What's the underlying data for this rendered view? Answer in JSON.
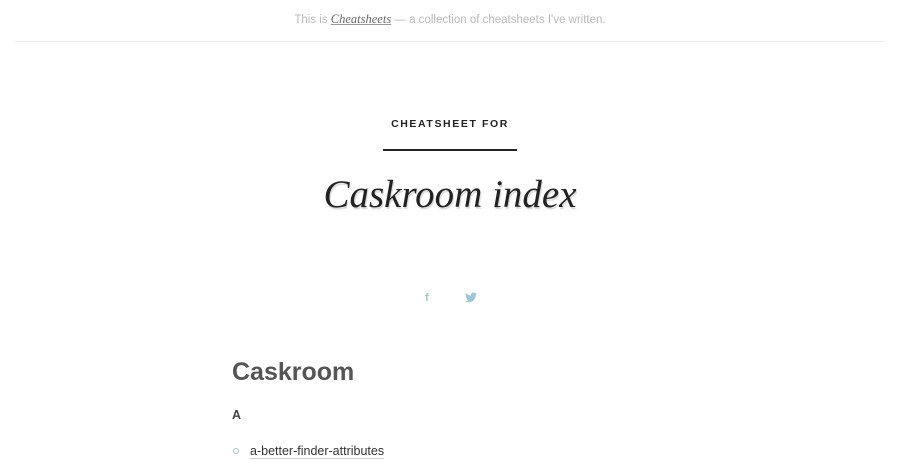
{
  "header": {
    "intro_prefix": "This is ",
    "site_name": "Cheatsheets",
    "intro_suffix": " — a collection of cheatsheets I've written."
  },
  "hero": {
    "label": "CHEATSHEET FOR",
    "title": "Caskroom index"
  },
  "share": {
    "facebook_icon": "f",
    "twitter_icon": "twitter-bird"
  },
  "content": {
    "heading": "Caskroom",
    "section_letter": "A",
    "items": [
      {
        "label": "a-better-finder-attributes"
      }
    ]
  },
  "colors": {
    "accent": "#9fc4d3",
    "text": "#333333",
    "muted": "#b9b9b9"
  }
}
